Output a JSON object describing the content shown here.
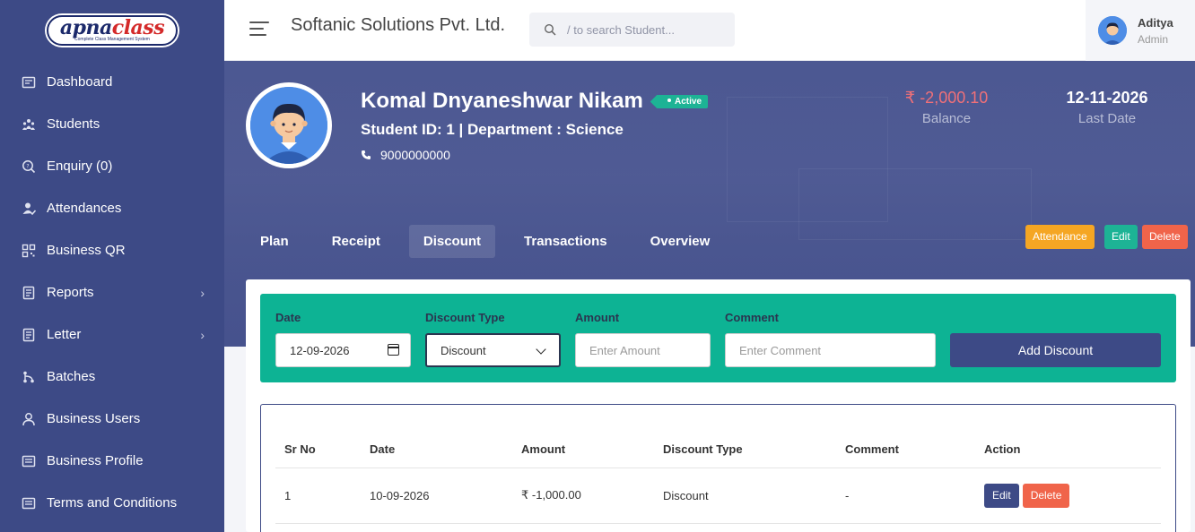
{
  "logo": {
    "part1": "apna",
    "part2": "class",
    "tagline": "Complete Class Management System"
  },
  "sidebar": {
    "items": [
      {
        "label": "Dashboard",
        "icon": "dashboard-icon",
        "chevron": false
      },
      {
        "label": "Students",
        "icon": "students-icon",
        "chevron": false
      },
      {
        "label": "Enquiry (0)",
        "icon": "enquiry-icon",
        "chevron": false
      },
      {
        "label": "Attendances",
        "icon": "attendance-icon",
        "chevron": false
      },
      {
        "label": "Business QR",
        "icon": "qr-icon",
        "chevron": false
      },
      {
        "label": "Reports",
        "icon": "reports-icon",
        "chevron": true
      },
      {
        "label": "Letter",
        "icon": "letter-icon",
        "chevron": true
      },
      {
        "label": "Batches",
        "icon": "batches-icon",
        "chevron": false
      },
      {
        "label": "Business Users",
        "icon": "user-icon",
        "chevron": false
      },
      {
        "label": "Business Profile",
        "icon": "profile-icon",
        "chevron": false
      },
      {
        "label": "Terms and Conditions",
        "icon": "terms-icon",
        "chevron": false
      }
    ]
  },
  "header": {
    "company": "Softanic Solutions Pvt. Ltd.",
    "search_placeholder": "/ to search Student...",
    "user_name": "Aditya",
    "user_role": "Admin"
  },
  "student": {
    "name": "Komal Dnyaneshwar Nikam",
    "status": "Active",
    "sub": "Student ID: 1  | Department : Science",
    "phone": "9000000000",
    "balance": "₹ -2,000.10",
    "balance_label": "Balance",
    "last_date": "12-11-2026",
    "last_date_label": "Last Date"
  },
  "tabs": [
    {
      "label": "Plan",
      "active": false
    },
    {
      "label": "Receipt",
      "active": false
    },
    {
      "label": "Discount",
      "active": true
    },
    {
      "label": "Transactions",
      "active": false
    },
    {
      "label": "Overview",
      "active": false
    }
  ],
  "actions": {
    "attendance": "Attendance",
    "edit": "Edit",
    "delete": "Delete"
  },
  "form": {
    "date_label": "Date",
    "date_value": "12-09-2026",
    "type_label": "Discount Type",
    "type_value": "Discount",
    "amount_label": "Amount",
    "amount_placeholder": "Enter Amount",
    "comment_label": "Comment",
    "comment_placeholder": "Enter Comment",
    "submit": "Add Discount"
  },
  "table": {
    "headers": [
      "Sr No",
      "Date",
      "Amount",
      "Discount Type",
      "Comment",
      "Action"
    ],
    "rows": [
      {
        "sr": "1",
        "date": "10-09-2026",
        "amount": "₹ -1,000.00",
        "type": "Discount",
        "comment": "-",
        "edit": "Edit",
        "delete": "Delete"
      }
    ]
  },
  "colors": {
    "sidebar": "#3d4a86",
    "accent_green": "#0db394",
    "balance_red": "#f07078",
    "warning": "#f5a623",
    "danger": "#f0644a"
  }
}
